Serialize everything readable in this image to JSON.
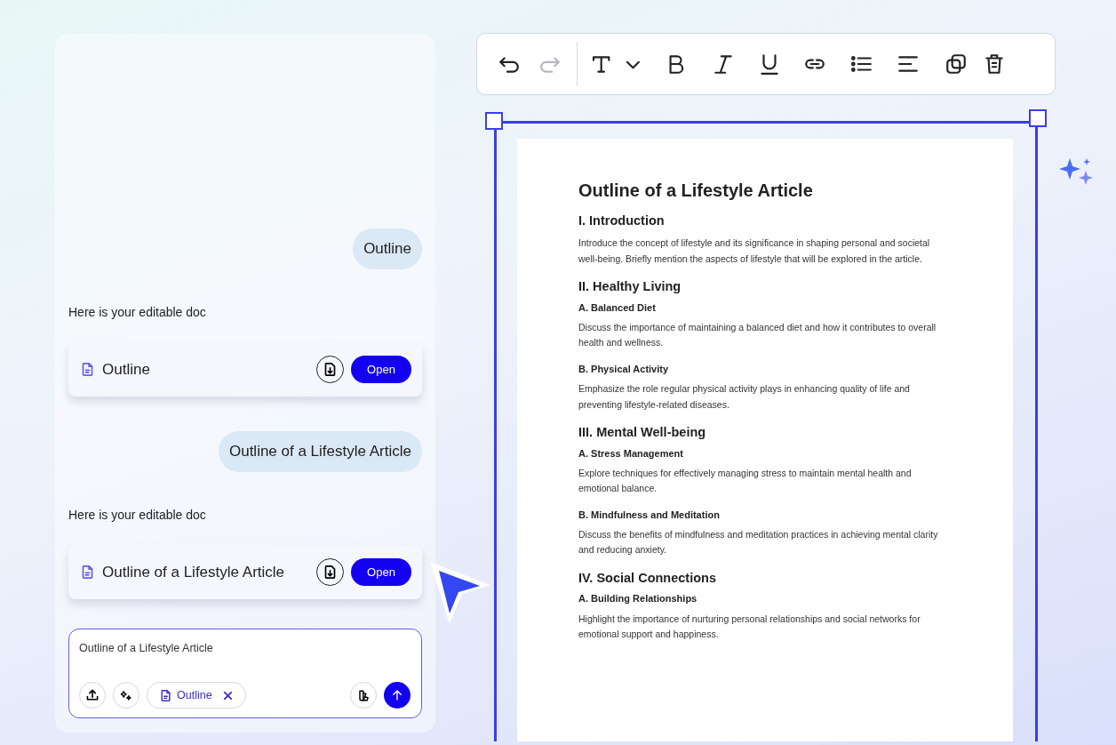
{
  "toolbar": {
    "buttons": [
      {
        "kind": "undo",
        "disabled": false
      },
      {
        "kind": "redo",
        "disabled": true
      },
      {
        "kind": "text",
        "disabled": false
      },
      {
        "kind": "bold",
        "disabled": false
      },
      {
        "kind": "italic",
        "disabled": false
      },
      {
        "kind": "underline",
        "disabled": false
      },
      {
        "kind": "link",
        "disabled": false
      },
      {
        "kind": "list",
        "disabled": false
      },
      {
        "kind": "align",
        "disabled": false
      },
      {
        "kind": "duplicate",
        "disabled": false
      },
      {
        "kind": "delete",
        "disabled": false
      }
    ]
  },
  "chat": {
    "messages": [
      {
        "kind": "user",
        "text": "Outline"
      },
      {
        "kind": "assistant",
        "text": "Here is your editable doc"
      },
      {
        "kind": "doc",
        "title": "Outline",
        "button": "Open"
      },
      {
        "kind": "user",
        "text": "Outline of a Lifestyle Article"
      },
      {
        "kind": "assistant",
        "text": "Here is your editable doc"
      },
      {
        "kind": "doc",
        "title": "Outline of a Lifestyle Article",
        "button": "Open"
      }
    ],
    "composer": {
      "value": "Outline of a Lifestyle Article",
      "chip": "Outline"
    }
  },
  "document": {
    "title": "Outline of a Lifestyle Article",
    "sections": [
      {
        "heading": "I. Introduction",
        "body": "Introduce the concept of lifestyle and its significance in shaping personal and societal well-being. Briefly mention the aspects of lifestyle that will be explored in the article."
      },
      {
        "heading": "II. Healthy Living",
        "subsections": [
          {
            "heading": "A. Balanced Diet",
            "body": "Discuss the importance of maintaining a balanced diet and how it contributes to overall health and wellness."
          },
          {
            "heading": "B. Physical Activity",
            "body": "Emphasize the role regular physical activity plays in enhancing quality of life and preventing lifestyle-related diseases."
          }
        ]
      },
      {
        "heading": "III. Mental Well-being",
        "subsections": [
          {
            "heading": "A. Stress Management",
            "body": "Explore techniques for effectively managing stress to maintain mental health and emotional balance."
          },
          {
            "heading": "B. Mindfulness and Meditation",
            "body": "Discuss the benefits of mindfulness and meditation practices in achieving mental clarity and reducing anxiety."
          }
        ]
      },
      {
        "heading": "IV. Social Connections",
        "subsections": [
          {
            "heading": "A. Building Relationships",
            "body": "Highlight the importance of nurturing personal relationships and social networks for emotional support and happiness."
          }
        ]
      }
    ]
  }
}
